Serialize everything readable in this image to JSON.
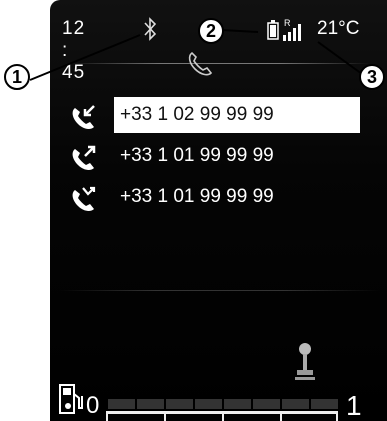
{
  "status_bar": {
    "time": "12 : 45",
    "temperature": "21°C",
    "signal_roaming_mark": "R"
  },
  "calls": [
    {
      "number": "+33 1 02 99 99 99",
      "type": "incoming",
      "selected": true
    },
    {
      "number": "+33 1 01 99 99 99",
      "type": "outgoing",
      "selected": false
    },
    {
      "number": "+33 1 01 99 99 99",
      "type": "missed",
      "selected": false
    }
  ],
  "fuel": {
    "empty_label": "0",
    "full_label": "1"
  },
  "callouts": [
    "1",
    "2",
    "3"
  ],
  "colors": {
    "screen_bg": "#000000",
    "text": "#ffffff",
    "selection": "#ffffff"
  },
  "icons": [
    "bluetooth-icon",
    "battery-icon",
    "signal-icon",
    "phone-icon",
    "incoming-call-icon",
    "outgoing-call-icon",
    "missed-call-icon",
    "gear-lever-icon",
    "fuel-pump-icon"
  ]
}
